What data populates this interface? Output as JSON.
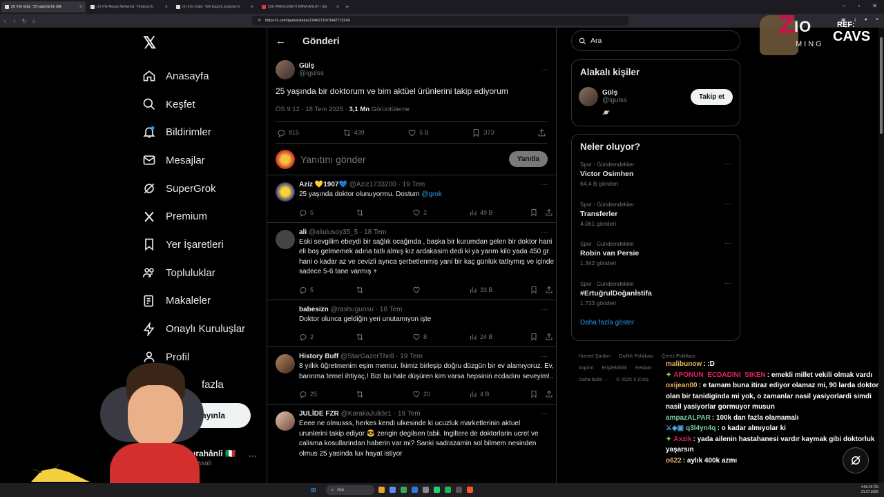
{
  "browser": {
    "tabs": [
      {
        "title": "(3) X'te Gülş: \"25 yaşında bir dok",
        "active": true
      },
      {
        "title": "(2) X'te Asayiş Berkemal: \"(Kürkçü) b",
        "active": false
      },
      {
        "title": "(2) X'te Cabo: \"Efe bugünç karşıdan k",
        "active": false
      },
      {
        "title": "(19) FRENLEMEYİ BANA ANLAT | Sta",
        "active": false
      }
    ],
    "url": "https://x.com/igulss/status/1946271973442773249"
  },
  "nav": {
    "items": [
      {
        "label": "Anasayfa",
        "icon": "home-icon"
      },
      {
        "label": "Keşfet",
        "icon": "search-icon"
      },
      {
        "label": "Bildirimler",
        "icon": "bell-icon",
        "badge": "3"
      },
      {
        "label": "Mesajlar",
        "icon": "mail-icon"
      },
      {
        "label": "SuperGrok",
        "icon": "grok-icon"
      },
      {
        "label": "Premium",
        "icon": "x-icon"
      },
      {
        "label": "Yer İşaretleri",
        "icon": "bookmark-icon"
      },
      {
        "label": "Topluluklar",
        "icon": "communities-icon"
      },
      {
        "label": "Makaleler",
        "icon": "articles-icon"
      },
      {
        "label": "Onaylı Kuruluşlar",
        "icon": "lightning-icon"
      },
      {
        "label": "Profil",
        "icon": "profile-icon"
      },
      {
        "label": "fazla",
        "icon": "more-icon"
      }
    ],
    "post_button": "yayınla",
    "account_name": "ırahânli 🇮🇹",
    "account_handle": "pasali"
  },
  "header": {
    "title": "Gönderi"
  },
  "post": {
    "name": "Gülş",
    "handle": "@igulss",
    "text": "25 yaşında bir doktorum ve bim aktüel ürünlerini takip ediyorum",
    "time": "ÖS 9:12 · 18 Tem 2025 · ",
    "views_num": "3,1 Mn",
    "views_label": "Görüntüleme",
    "replies": "815",
    "reposts": "439",
    "likes": "5 B",
    "bookmarks": "373"
  },
  "reply_box": {
    "placeholder": "Yanıtını gönder",
    "button": "Yanıtla"
  },
  "replies": [
    {
      "name": "Aziz 💛1907💙",
      "handle": "@Aziz1733200",
      "time": "· 19 Tem",
      "text": "25 yaşında doktor olunuyormu. Dostum ",
      "mention": "@grok",
      "replies": "5",
      "reposts": "",
      "likes": "2",
      "views": "49 B"
    },
    {
      "name": "ali",
      "handle": "@aliulusoy35_5",
      "time": "· 18 Tem",
      "text": "Eski sevgilim ebeydi bir sağlık ocağında , başka bir kurumdan gelen bir doktor hani eli boş gelmemek adına tatlı almış kız ardakasim dedi ki ya yarım kilo yada 450 gr hani o kadar az ve cevizli ayrıca şerbetlenmiş yani bir kaç günlük tatlıymış ve içinde sadece 5-6 tane varmış +",
      "mention": "",
      "replies": "5",
      "reposts": "",
      "likes": "",
      "views": "33 B"
    },
    {
      "name": "babesizn",
      "handle": "@rashugunsu",
      "time": "· 18 Tem",
      "text": "Doktor olunca geldiğin yeri unutamıyon işte",
      "mention": "",
      "replies": "2",
      "reposts": "",
      "likes": "8",
      "views": "24 B"
    },
    {
      "name": "History Buff",
      "handle": "@StarGazerThrill",
      "time": "· 19 Tem",
      "text": "8 yıllık öğretmenim eşim memur. İkimiz birleşip doğru düzgün bir ev alamıyoruz. Ev, barınma temel ihtiyaç,! Bizi bu hale düşüren kim varsa hepsinin ecdadını  seveyim!..",
      "mention": "",
      "replies": "25",
      "reposts": "",
      "likes": "20",
      "views": "4 B"
    },
    {
      "name": "JULİDE FZR",
      "handle": "@KarakaJulide1",
      "time": "· 19 Tem",
      "text": "Eeee ne olmusss, herkes kendi ulkesinde ki ucuzluk marketlerinin aktuel urunlerini takip ediyor 😎 zengin degilsen tabii. Ingiltere de doktorlarin ucret ve calisma kosullarindan haberin var mi? Sanki sadrazamin sol bilmem nesinden olmus 25 yasinda lux hayat istiyor",
      "mention": "",
      "replies": "",
      "reposts": "",
      "likes": "",
      "views": ""
    }
  ],
  "search": {
    "placeholder": "Ara"
  },
  "related": {
    "title": "Alakalı kişiler",
    "name": "Gülş",
    "handle": "@igulss",
    "follow": "Takip et",
    "emoji": "🪐"
  },
  "trends": {
    "title": "Neler oluyor?",
    "items": [
      {
        "category": "Spor · Gündemdekiler",
        "title": "Victor Osimhen",
        "count": "64,4 B gönderi"
      },
      {
        "category": "Spor · Gündemdekiler",
        "title": "Transferler",
        "count": "4.061 gönderi"
      },
      {
        "category": "Spor · Gündemdekiler",
        "title": "Robin van Persie",
        "count": "1.342 gönderi"
      },
      {
        "category": "Spor · Gündemdekiler",
        "title": "#ErtuğrulDoğanİstifa",
        "count": "1.733 gönderi"
      }
    ],
    "show_more": "Daha fazla göster"
  },
  "footer": [
    "Hizmet Şartları",
    "Gizlilik Politikası",
    "Çerez Politikası",
    "Imprint",
    "Erişilebilirlik",
    "Reklam",
    "Daha fazla ···",
    "© 2025 X Corp."
  ],
  "overlay": {
    "brand_z": "Z",
    "brand_io": "IO",
    "brand_sub": "MING",
    "ref": "REF:",
    "cavs": "CAVS",
    "chat": [
      {
        "user": "malibunow",
        "color": "#e6b85c",
        "badge": "",
        "text": ": :D"
      },
      {
        "user": "APONUN_ECDADINI_SIKEN",
        "color": "#e0245e",
        "badge": "✦",
        "text": ": emekli millet vekili olmak vardı"
      },
      {
        "user": "oxijean00",
        "color": "#e6b85c",
        "badge": "",
        "text": ": e tamam buna itiraz ediyor olamaz mi, 90 larda doktor olan bir tanidigindа mi yok, o zamanlar nasil yasiyorlardi simdi nasil yasiyorlar gormuyor musun"
      },
      {
        "user": "ampazALPAR",
        "color": "#7cd3a4",
        "badge": "",
        "text": ": 100k dan fazla olamamalı"
      },
      {
        "user": "q3l4yn4q",
        "color": "#7cd3a4",
        "badge": "⚔◆▣",
        "text": ": o kadar almıyolar ki"
      },
      {
        "user": "Axzik",
        "color": "#e0245e",
        "badge": "✦",
        "text": ": yada ailenin hastahanesi vardır kaymak gibi doktorluk yaşarsın"
      },
      {
        "user": "o622",
        "color": "#e6b85c",
        "badge": "",
        "text": ": aylık 400k azmı"
      }
    ]
  },
  "taskbar": {
    "search": "Ara",
    "time": "4:56:29 ÖS",
    "date": "21.07.2025"
  }
}
